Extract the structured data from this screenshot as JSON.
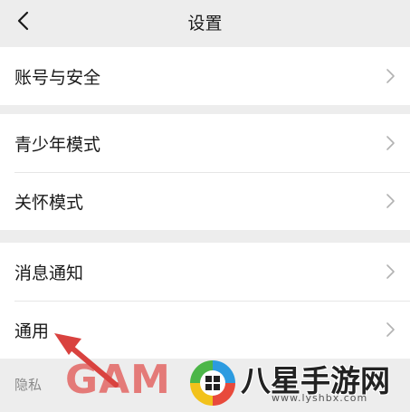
{
  "header": {
    "title": "设置",
    "back_icon": "chevron-left-icon"
  },
  "groups": [
    {
      "items": [
        {
          "label": "账号与安全"
        }
      ]
    },
    {
      "items": [
        {
          "label": "青少年模式"
        },
        {
          "label": "关怀模式"
        }
      ]
    },
    {
      "items": [
        {
          "label": "消息通知"
        },
        {
          "label": "通用"
        }
      ]
    }
  ],
  "section_header": "隐私",
  "row_chevron_icon": "chevron-right-icon",
  "annotation": {
    "icon": "red-arrow-icon",
    "color": "#d9423f"
  },
  "watermark": {
    "text": "GAM",
    "brand": "八星手游网",
    "url": "www.lyshbx.com"
  }
}
